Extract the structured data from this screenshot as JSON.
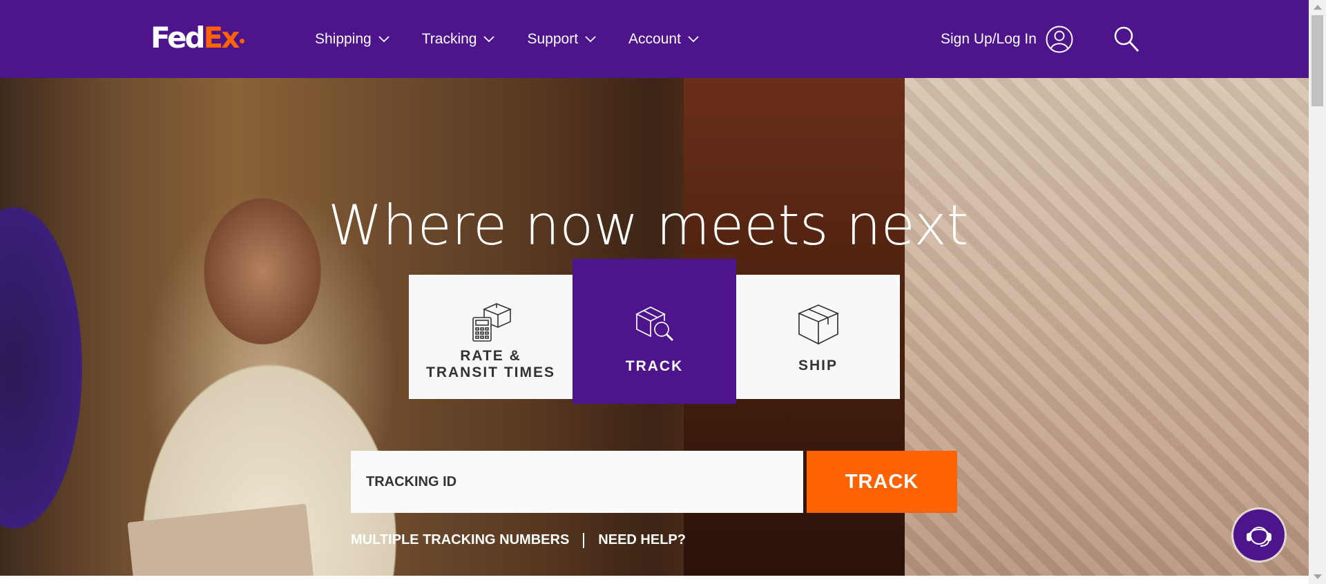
{
  "brand": {
    "logo_fed": "Fed",
    "logo_ex": "Ex",
    "purple": "#4d148c",
    "orange": "#ff6200"
  },
  "header": {
    "nav": [
      {
        "label": "Shipping"
      },
      {
        "label": "Tracking"
      },
      {
        "label": "Support"
      },
      {
        "label": "Account"
      }
    ],
    "signin_label": "Sign Up/Log In",
    "icons": [
      "chevron-down-icon",
      "user-icon",
      "search-icon"
    ]
  },
  "hero": {
    "headline": "Where now meets next",
    "tabs": [
      {
        "label": "RATE & TRANSIT TIMES",
        "icon": "calculator-boxes-icon",
        "selected": false
      },
      {
        "label": "TRACK",
        "icon": "box-magnifier-icon",
        "selected": true
      },
      {
        "label": "SHIP",
        "icon": "box-icon",
        "selected": false
      }
    ],
    "tracking": {
      "placeholder": "TRACKING ID",
      "value": "",
      "button_label": "TRACK"
    },
    "links": {
      "multiple": "MULTIPLE TRACKING NUMBERS",
      "help": "NEED HELP?"
    }
  },
  "chat": {
    "icon": "chat-agent-icon"
  }
}
